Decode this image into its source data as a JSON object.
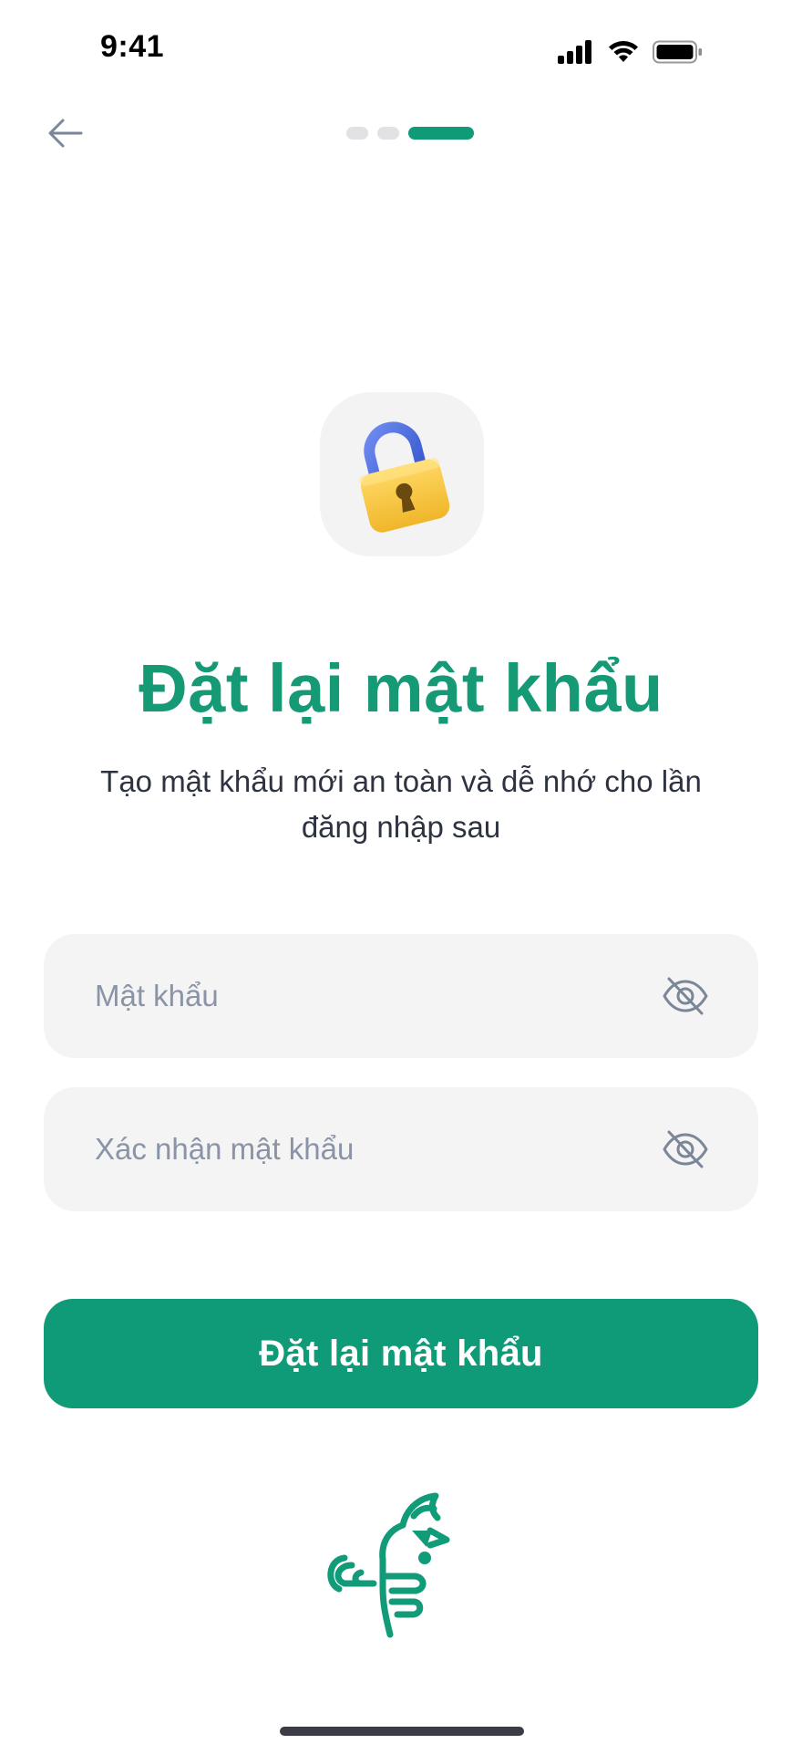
{
  "status_bar": {
    "time": "9:41"
  },
  "nav": {
    "back_icon": "arrow-left-icon",
    "steps_total": 3,
    "current_step": 3
  },
  "header_icon": "padlock-icon",
  "title": "Đặt lại mật khẩu",
  "subtitle": "Tạo mật khẩu mới an toàn và dễ nhớ cho lần đăng nhập sau",
  "form": {
    "password": {
      "value": "",
      "placeholder": "Mật khẩu",
      "toggle_icon": "eye-off-icon"
    },
    "confirm_password": {
      "value": "",
      "placeholder": "Xác nhận mật khẩu",
      "toggle_icon": "eye-off-icon"
    }
  },
  "submit_label": "Đặt lại mật khẩu",
  "logo_icon": "rooster-logo-icon",
  "colors": {
    "accent": "#0f9a78",
    "title": "#169a76",
    "field_bg": "#f4f4f5",
    "placeholder": "#8a94a6",
    "step_inactive": "#e2e2e4"
  }
}
